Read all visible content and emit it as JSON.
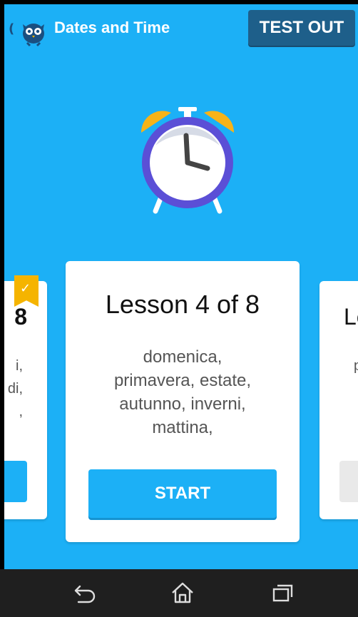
{
  "header": {
    "back_glyph": "(",
    "title": "Dates and Time",
    "test_out_label": "TEST OUT"
  },
  "current_card": {
    "title": "Lesson 4 of 8",
    "words": [
      "domenica,",
      "primavera, estate,",
      "autunno, inverni,",
      "mattina,"
    ],
    "start_label": "START"
  },
  "prev_card": {
    "number_fragment": "8",
    "word_fragments": [
      "i,",
      "di,",
      ","
    ],
    "completed": true
  },
  "next_card": {
    "title_fragment": "Le",
    "word_fragment": "p"
  },
  "colors": {
    "background": "#1cb0f6",
    "test_out_bg": "#1e5f8a",
    "start_button": "#1cb0f6",
    "ribbon": "#f5b400",
    "clock_bells": "#f7b318",
    "clock_rim": "#5b4fd6",
    "navbar": "#1f1f1f"
  },
  "icons": {
    "app": "owl-icon",
    "lesson_art": "alarm-clock-icon",
    "completed": "checkmark-icon",
    "nav": [
      "back-arrow-icon",
      "home-icon",
      "recent-apps-icon"
    ]
  }
}
